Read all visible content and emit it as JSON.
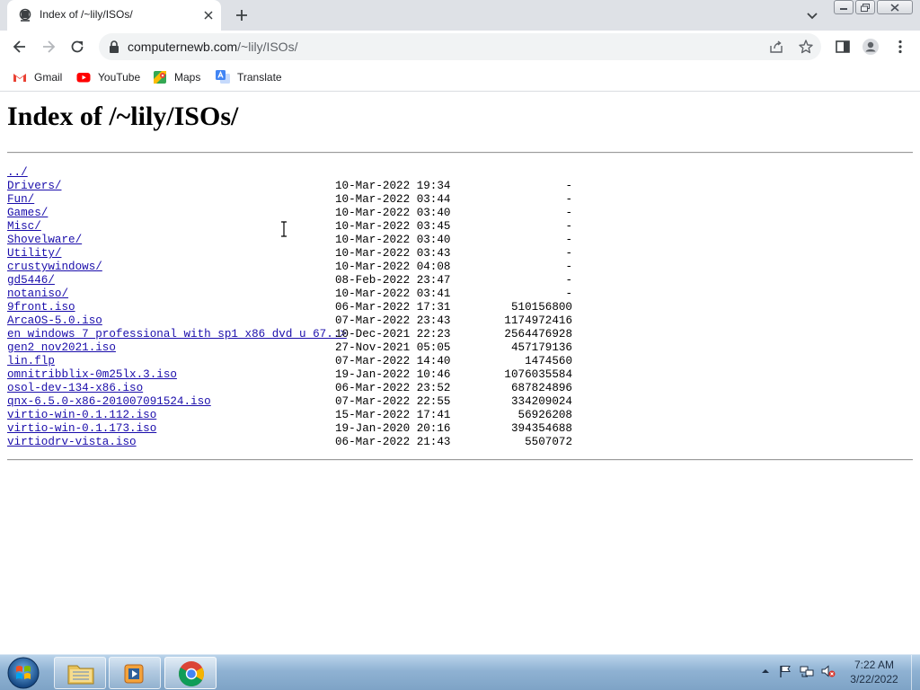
{
  "browser": {
    "tab": {
      "title": "Index of /~lily/ISOs/"
    },
    "address": {
      "host": "computernewb.com",
      "path": "/~lily/ISOs/"
    },
    "bookmarks": [
      {
        "label": "Gmail",
        "icon": "gmail-icon"
      },
      {
        "label": "YouTube",
        "icon": "youtube-icon"
      },
      {
        "label": "Maps",
        "icon": "maps-icon"
      },
      {
        "label": "Translate",
        "icon": "translate-icon"
      }
    ]
  },
  "page": {
    "heading": "Index of /~lily/ISOs/",
    "entries": [
      {
        "name": "../",
        "date": "",
        "size": ""
      },
      {
        "name": "Drivers/",
        "date": "10-Mar-2022 19:34",
        "size": "-"
      },
      {
        "name": "Fun/",
        "date": "10-Mar-2022 03:44",
        "size": "-"
      },
      {
        "name": "Games/",
        "date": "10-Mar-2022 03:40",
        "size": "-"
      },
      {
        "name": "Misc/",
        "date": "10-Mar-2022 03:45",
        "size": "-"
      },
      {
        "name": "Shovelware/",
        "date": "10-Mar-2022 03:40",
        "size": "-"
      },
      {
        "name": "Utility/",
        "date": "10-Mar-2022 03:43",
        "size": "-"
      },
      {
        "name": "crustywindows/",
        "date": "10-Mar-2022 04:08",
        "size": "-"
      },
      {
        "name": "gd5446/",
        "date": "08-Feb-2022 23:47",
        "size": "-"
      },
      {
        "name": "notaniso/",
        "date": "10-Mar-2022 03:41",
        "size": "-"
      },
      {
        "name": "9front.iso",
        "date": "06-Mar-2022 17:31",
        "size": "510156800"
      },
      {
        "name": "ArcaOS-5.0.iso",
        "date": "07-Mar-2022 23:43",
        "size": "1174972416"
      },
      {
        "name": "en_windows_7_professional_with_sp1_x86_dvd_u_67..>",
        "date": "10-Dec-2021 22:23",
        "size": "2564476928"
      },
      {
        "name": "gen2_nov2021.iso",
        "date": "27-Nov-2021 05:05",
        "size": "457179136"
      },
      {
        "name": "lin.flp",
        "date": "07-Mar-2022 14:40",
        "size": "1474560"
      },
      {
        "name": "omnitribblix-0m25lx.3.iso",
        "date": "19-Jan-2022 10:46",
        "size": "1076035584"
      },
      {
        "name": "osol-dev-134-x86.iso",
        "date": "06-Mar-2022 23:52",
        "size": "687824896"
      },
      {
        "name": "qnx-6.5.0-x86-201007091524.iso",
        "date": "07-Mar-2022 22:55",
        "size": "334209024"
      },
      {
        "name": "virtio-win-0.1.112.iso",
        "date": "15-Mar-2022 17:41",
        "size": "56926208"
      },
      {
        "name": "virtio-win-0.1.173.iso",
        "date": "19-Jan-2020 20:16",
        "size": "394354688"
      },
      {
        "name": "virtiodrv-vista.iso",
        "date": "06-Mar-2022 21:43",
        "size": "5507072"
      }
    ]
  },
  "taskbar": {
    "time": "7:22 AM",
    "date": "3/22/2022"
  },
  "colors": {
    "link": "#1a0dab",
    "tabstrip": "#dee1e6",
    "omnibox": "#f1f3f4"
  }
}
